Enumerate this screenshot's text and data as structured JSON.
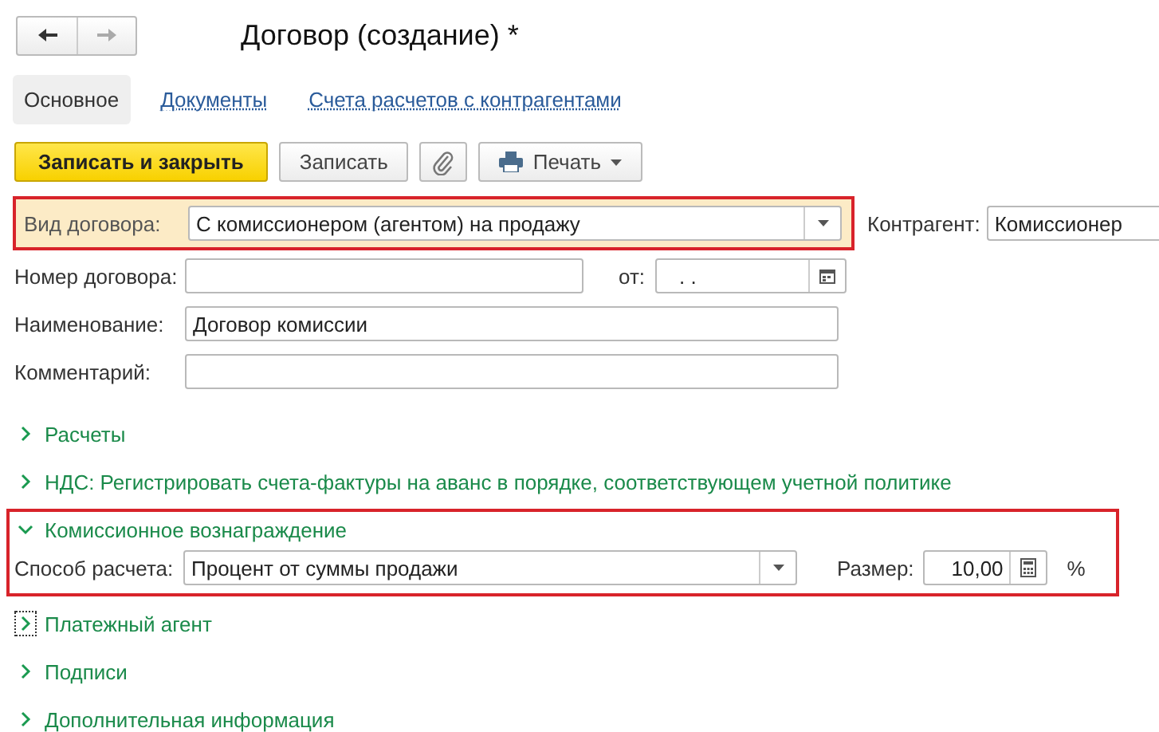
{
  "window": {
    "title": "Договор (создание) *"
  },
  "nav": [
    {
      "kind": "back",
      "disabled": false
    },
    {
      "kind": "forward",
      "disabled": true
    }
  ],
  "tabs": [
    {
      "label": "Основное",
      "selected": true
    },
    {
      "label": "Документы",
      "selected": false
    },
    {
      "label": "Счета расчетов с контрагентами",
      "selected": false
    }
  ],
  "toolbar": [
    {
      "kind": "primary",
      "label": "Записать и закрыть"
    },
    {
      "kind": "plain",
      "label": "Записать"
    },
    {
      "kind": "attach"
    },
    {
      "kind": "print",
      "label": "Печать"
    }
  ],
  "contract_type": {
    "label": "Вид договора:",
    "value": "С комиссионером (агентом) на продажу",
    "highlighted": true
  },
  "counterparty": {
    "label": "Контрагент:",
    "value": "Комиссионер"
  },
  "number": {
    "label": "Номер договора:"
  },
  "date": {
    "label": "от:",
    "value": ". ."
  },
  "name": {
    "label": "Наименование:",
    "value": "Договор комиссии"
  },
  "comment": {
    "label": "Комментарий:"
  },
  "sections": [
    {
      "title": "Расчеты",
      "expanded": false,
      "focused": false,
      "highlighted": false
    },
    {
      "title": "НДС: Регистрировать счета-фактуры на аванс в порядке, соответствующем учетной политике",
      "expanded": false,
      "focused": false,
      "highlighted": false
    },
    {
      "title": "Комиссионное вознаграждение",
      "expanded": true,
      "focused": false,
      "highlighted": true,
      "method": {
        "label": "Способ расчета:",
        "value": "Процент от суммы продажи"
      },
      "size": {
        "label": "Размер:",
        "value": "10,00",
        "unit": "%"
      }
    },
    {
      "title": "Платежный агент",
      "expanded": false,
      "focused": true,
      "highlighted": false
    },
    {
      "title": "Подписи",
      "expanded": false,
      "focused": false,
      "highlighted": false
    },
    {
      "title": "Дополнительная информация",
      "expanded": false,
      "focused": false,
      "highlighted": false
    }
  ]
}
